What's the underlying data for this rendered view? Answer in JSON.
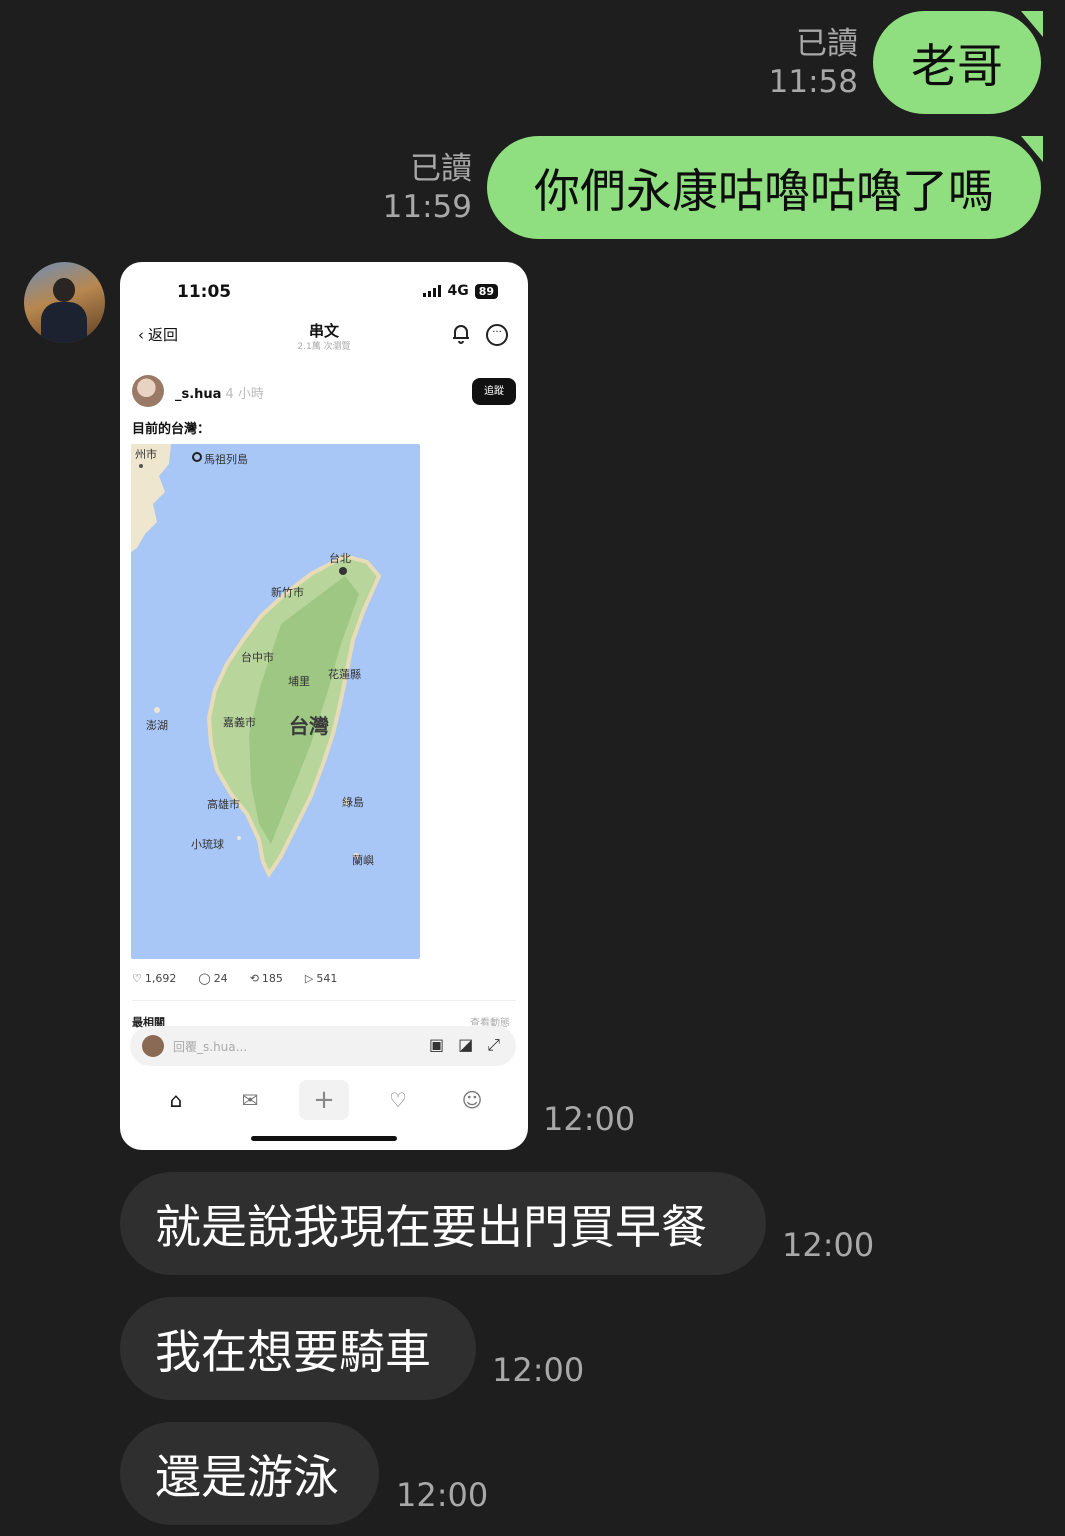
{
  "messages_out": [
    {
      "read": "已讀",
      "time": "11:58",
      "text": "老哥"
    },
    {
      "read": "已讀",
      "time": "11:59",
      "text": "你們永康咕嚕咕嚕了嗎"
    }
  ],
  "image_message": {
    "time": "12:00",
    "screenshot": {
      "status_time": "11:05",
      "network": "4G",
      "battery": "89",
      "back_label": "返回",
      "title": "串文",
      "subtitle": "2.1萬 次瀏覽",
      "username": "_s.hua",
      "post_age": "4 小時",
      "follow_label": "追蹤",
      "post_text": "目前的台灣：",
      "map_labels": {
        "city_top_left": "州市",
        "matsu": "馬祖列島",
        "taipei": "台北",
        "hsinchu": "新竹市",
        "taichung": "台中市",
        "puli": "埔里",
        "hualien": "花蓮縣",
        "penghu": "澎湖",
        "chiayi": "嘉義市",
        "taiwan": "台灣",
        "kaohsiung": "高雄市",
        "green_island": "綠島",
        "xiaoliuqiu": "小琉球",
        "orchid_island": "蘭嶼"
      },
      "likes": "1,692",
      "comments": "24",
      "reposts": "185",
      "shares": "541",
      "relevance_label": "最相關",
      "activity_label": "查看動態",
      "reply_placeholder": "回覆_s.hua..."
    }
  },
  "messages_in": [
    {
      "text": "就是說我現在要出門買早餐",
      "time": "12:00"
    },
    {
      "text": "我在想要騎車",
      "time": "12:00"
    },
    {
      "text": "還是游泳",
      "time": "12:00"
    }
  ],
  "colors": {
    "background": "#1e1e1e",
    "outgoing_bubble": "#8fde7f",
    "incoming_bubble": "#2f2f2f",
    "meta_text": "#a8a8a8"
  }
}
